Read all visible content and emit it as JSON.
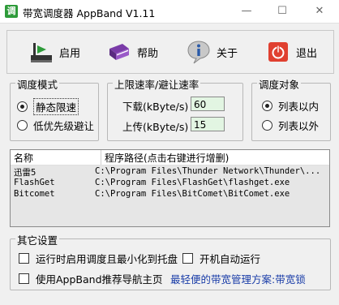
{
  "window": {
    "title": "带宽调度器 AppBand V1.11",
    "icon_char": "调"
  },
  "toolbar": {
    "start_label": "启用",
    "help_label": "帮助",
    "about_label": "关于",
    "exit_label": "退出"
  },
  "mode_group": {
    "title": "调度模式",
    "options": [
      {
        "label": "静态限速",
        "selected": true
      },
      {
        "label": "低优先级避让",
        "selected": false
      }
    ]
  },
  "rate_group": {
    "title": "上限速率/避让速率",
    "download_label": "下载(kByte/s)",
    "download_value": "60",
    "upload_label": "上传(kByte/s)",
    "upload_value": "15"
  },
  "target_group": {
    "title": "调度对象",
    "options": [
      {
        "label": "列表以内",
        "selected": true
      },
      {
        "label": "列表以外",
        "selected": false
      }
    ]
  },
  "list": {
    "columns": [
      "名称",
      "程序路径(点击右键进行增删)"
    ],
    "rows": [
      {
        "name": "迅雷5",
        "path": "C:\\Program Files\\Thunder Network\\Thunder\\..."
      },
      {
        "name": "FlashGet",
        "path": "C:\\Program Files\\FlashGet\\flashget.exe"
      },
      {
        "name": "Bitcomet",
        "path": "C:\\Program Files\\BitComet\\BitComet.exe"
      }
    ]
  },
  "other_settings": {
    "title": "其它设置",
    "minimize_to_tray_label": "运行时启用调度且最小化到托盘",
    "autostart_label": "开机自动运行",
    "homepage_label": "使用AppBand推荐导航主页",
    "promo_text": "最轻便的带宽管理方案:带宽锁"
  },
  "colors": {
    "promo": "#1a3da8",
    "input_bg": "#e2f5e2",
    "accent_green": "#2e9b3a",
    "exit_red": "#e04030"
  }
}
